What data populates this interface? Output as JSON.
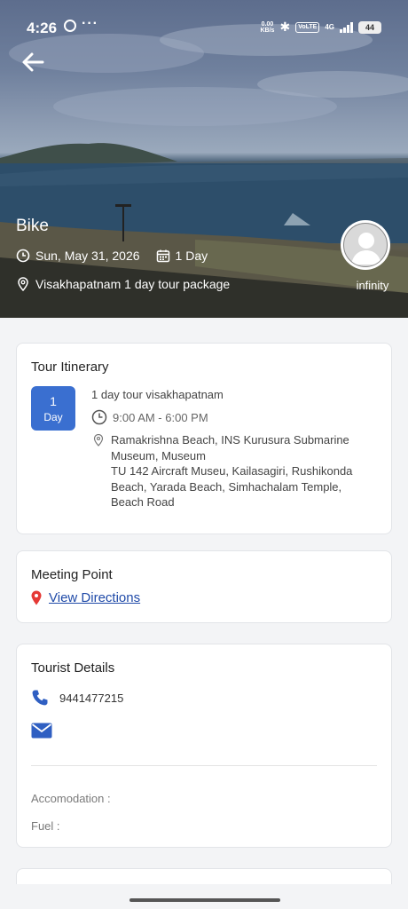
{
  "status_bar": {
    "time": "4:26",
    "speed_value": "0.00",
    "speed_unit": "KB/s",
    "network_chip": "VoLTE",
    "network_type": "4G",
    "battery": "44"
  },
  "hero": {
    "title": "Bike",
    "date": "Sun, May 31, 2026",
    "duration": "1 Day",
    "package": "Visakhapatnam 1 day tour package",
    "user_name": "infinity"
  },
  "itinerary": {
    "title": "Tour Itinerary",
    "day_number": "1",
    "day_label": "Day",
    "name": "1 day tour visakhapatnam",
    "time": "9:00 AM - 6:00 PM",
    "places": "Ramakrishna Beach, INS Kurusura Submarine Museum, Museum\nTU 142 Aircraft Museu, Kailasagiri, Rushikonda Beach, Yarada Beach, Simhachalam Temple, Beach Road"
  },
  "meeting": {
    "title": "Meeting Point",
    "link": "View Directions"
  },
  "tourist": {
    "title": "Tourist Details",
    "phone": "9441477215",
    "accommodation_label": "Accomodation :",
    "fuel_label": "Fuel :"
  },
  "colors": {
    "accent": "#3a6fd0",
    "link": "#1f4aa8",
    "pin": "#e53935"
  }
}
